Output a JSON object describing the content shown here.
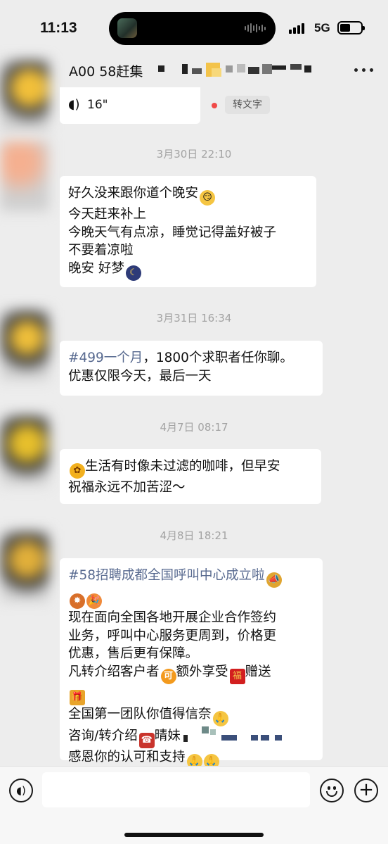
{
  "status_bar": {
    "time": "11:13",
    "network": "5G"
  },
  "header": {
    "title": "A00 58赶集"
  },
  "voice_message": {
    "duration": "16\"",
    "transcribe_label": "转文字"
  },
  "messages": [
    {
      "timestamp": "3月30日 22:10",
      "lines": [
        "好久没来跟你道个晚安",
        "今天赶来补上",
        "今晚天气有点凉，睡觉记得盖好被子",
        "不要着凉啦",
        "晚安  好梦"
      ]
    },
    {
      "timestamp": "3月31日 16:34",
      "link": "#499一个月",
      "lines": [
        "，1800个求职者任你聊。",
        "优惠仅限今天，最后一天"
      ]
    },
    {
      "timestamp": "4月7日 08:17",
      "lines": [
        "生活有时像未过滤的咖啡，但早安",
        "祝福永远不加苦涩～"
      ]
    },
    {
      "timestamp": "4月8日 18:21",
      "link": "#58招聘成都全国呼叫中心成立啦",
      "lines": [
        "现在面向全国各地开展企业合作签约",
        "业务，呼叫中心服务更周到，价格更",
        "优惠，售后更有保障。",
        "凡转介绍客户者",
        "额外享受",
        "赠送",
        "全国第一团队你值得信奈",
        "咨询/转介绍",
        "晴妹",
        "感恩你的认可和支持"
      ]
    }
  ],
  "emoji": {
    "smirk": "😏",
    "moon": "☾",
    "sunflower": "✿",
    "megaphone": "📣",
    "fireworks": "✸",
    "party": "🎉",
    "ke": "可",
    "red_envelope": "福",
    "gift": "🎁",
    "pray": "🙏",
    "phone": "☎"
  },
  "input": {
    "placeholder": ""
  },
  "colors": {
    "background": "#ededed",
    "bubble": "#ffffff",
    "link": "#57698f",
    "timestamp": "#a3a3a3",
    "unread_dot": "#f04a48"
  },
  "icons": [
    "voice-wave-icon",
    "more-icon",
    "voice-input-icon",
    "emoji-icon",
    "plus-icon"
  ]
}
